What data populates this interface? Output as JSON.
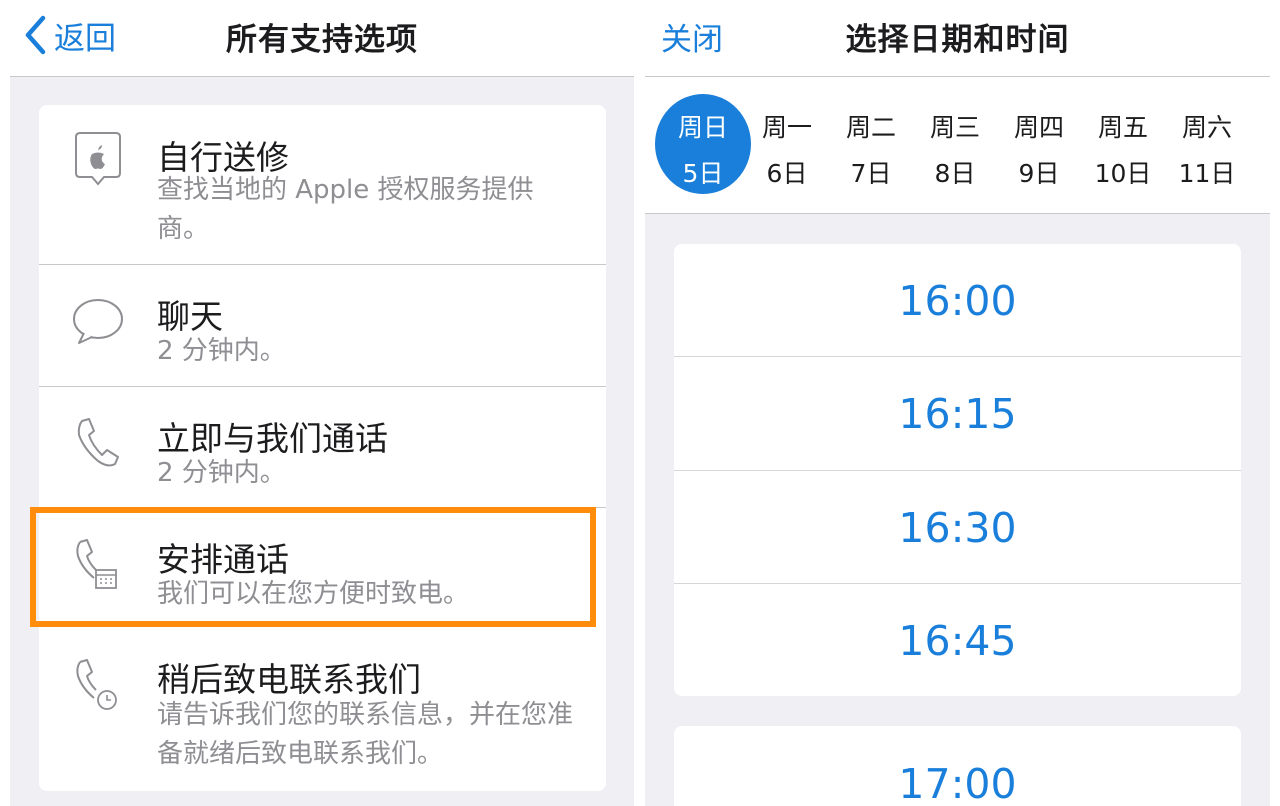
{
  "left_panel": {
    "back_label": "返回",
    "title": "所有支持选项",
    "options": [
      {
        "title": "自行送修",
        "subtitle": "查找当地的 Apple 授权服务提供商。",
        "icon": "apple-location-icon"
      },
      {
        "title": "聊天",
        "subtitle": "2 分钟内。",
        "icon": "chat-bubble-icon"
      },
      {
        "title": "立即与我们通话",
        "subtitle": "2 分钟内。",
        "icon": "phone-icon"
      },
      {
        "title": "安排通话",
        "subtitle": "我们可以在您方便时致电。",
        "icon": "phone-calendar-icon"
      },
      {
        "title": "稍后致电联系我们",
        "subtitle": "请告诉我们您的联系信息，并在您准备就绪后致电联系我们。",
        "icon": "phone-clock-icon"
      }
    ],
    "highlight_color": "#ff8c0a"
  },
  "right_panel": {
    "close_label": "关闭",
    "title": "选择日期和时间",
    "days": [
      {
        "dow": "周日",
        "date": "5日",
        "selected": true
      },
      {
        "dow": "周一",
        "date": "6日",
        "selected": false
      },
      {
        "dow": "周二",
        "date": "7日",
        "selected": false
      },
      {
        "dow": "周三",
        "date": "8日",
        "selected": false
      },
      {
        "dow": "周四",
        "date": "9日",
        "selected": false
      },
      {
        "dow": "周五",
        "date": "10日",
        "selected": false
      },
      {
        "dow": "周六",
        "date": "11日",
        "selected": false
      }
    ],
    "slot_groups": [
      [
        "16:00",
        "16:15",
        "16:30",
        "16:45"
      ],
      [
        "17:00"
      ]
    ],
    "accent_color": "#1a7fdb"
  }
}
